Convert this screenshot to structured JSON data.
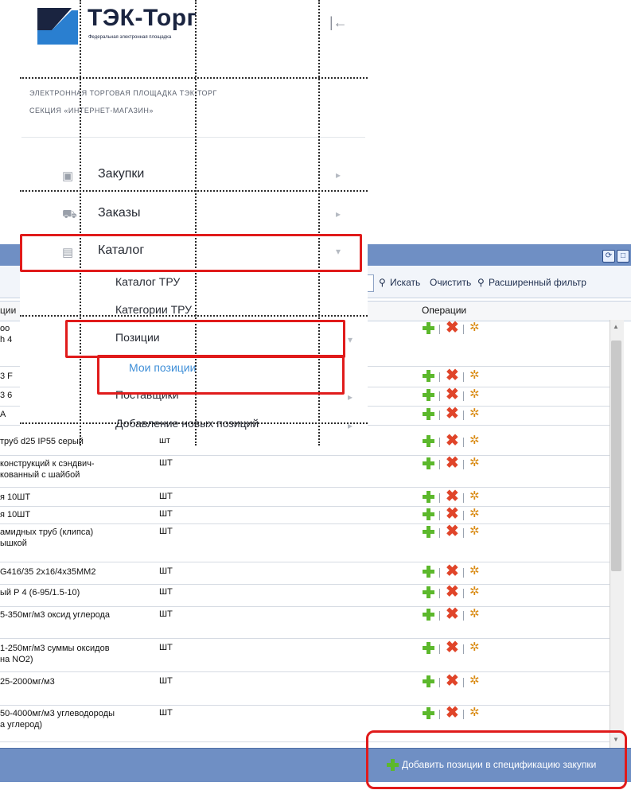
{
  "brand": {
    "name": "ТЭК-Торг",
    "tagline": "Федеральная электронная площадка",
    "section_line1": "ЭЛЕКТРОННАЯ ТОРГОВАЯ ПЛОЩАДКА ТЭК-ТОРГ",
    "section_line2": "СЕКЦИЯ «ИНТЕРНЕТ-МАГАЗИН»",
    "collapse_icon": "collapse-left-icon"
  },
  "sidebar": {
    "items": [
      {
        "label": "Закупки",
        "icon": "basket-icon"
      },
      {
        "label": "Заказы",
        "icon": "cart-icon"
      },
      {
        "label": "Каталог",
        "icon": "clipboard-icon"
      }
    ],
    "catalog_sub": [
      {
        "label": "Каталог ТРУ"
      },
      {
        "label": "Категории ТРУ"
      },
      {
        "label": "Позиции"
      },
      {
        "label": "Мои позиции"
      },
      {
        "label": "Поставщики"
      },
      {
        "label": "Добавление новых позиций"
      }
    ]
  },
  "grid": {
    "toolbar": {
      "search_label": "Искать",
      "clear_label": "Очистить",
      "advanced_filter_label": "Расширенный фильтр"
    },
    "columns": {
      "name_partial": "ции",
      "operations": "Операции"
    },
    "rows": [
      {
        "name": "оо\nh 4",
        "unit": ""
      },
      {
        "name": "3 F",
        "unit": ""
      },
      {
        "name": "3 6",
        "unit": ""
      },
      {
        "name": "A",
        "unit": ""
      },
      {
        "name": "труб d25 IP55 серый",
        "unit": "шт"
      },
      {
        "name": "конструкций к сэндвич-\nкованный с шайбой",
        "unit": "ШТ"
      },
      {
        "name": "я 10ШТ",
        "unit": "ШТ"
      },
      {
        "name": "я 10ШТ",
        "unit": "ШТ"
      },
      {
        "name": "амидных труб (клипса)\nышкой",
        "unit": "ШТ"
      },
      {
        "name": "G416/35 2x16/4x35MM2",
        "unit": "ШТ"
      },
      {
        "name": "ый Р 4 (6-95/1.5-10)",
        "unit": "ШТ"
      },
      {
        "name": "5-350мг/м3 оксид углерода",
        "unit": "ШТ"
      },
      {
        "name": "1-250мг/м3 суммы оксидов\nна NO2)",
        "unit": "ШТ"
      },
      {
        "name": "25-2000мг/м3",
        "unit": "ШТ"
      },
      {
        "name": "50-4000мг/м3 углеводороды\nа углерод)",
        "unit": "ШТ"
      }
    ],
    "footer_button": "Добавить позиции в спецификацию закупки"
  },
  "colors": {
    "accent_blue": "#6f8fc4",
    "highlight_red": "#e01b1b",
    "add_green": "#5cb82c",
    "delete_red": "#e0452a"
  }
}
